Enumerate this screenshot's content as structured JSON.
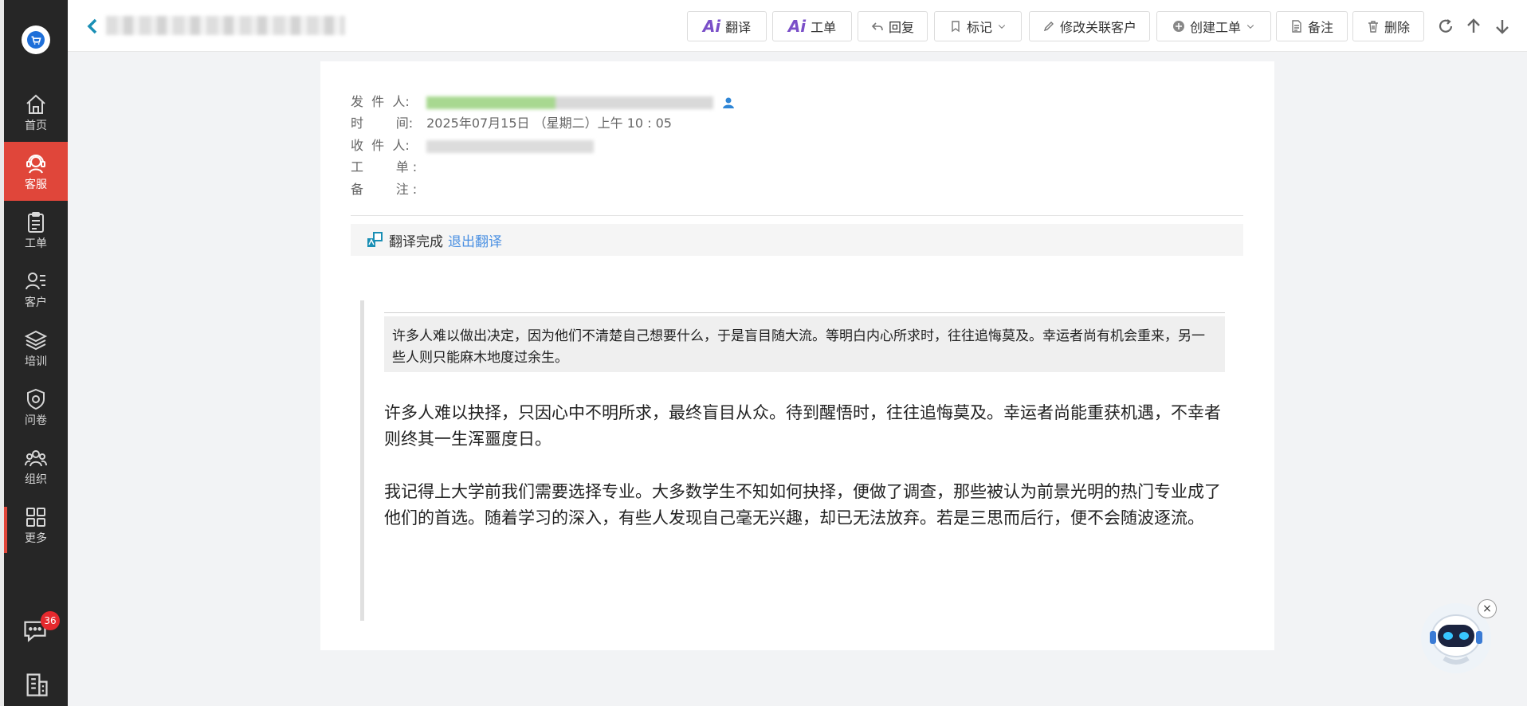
{
  "sidebar": {
    "items": [
      {
        "label": "首页",
        "icon": "home-icon"
      },
      {
        "label": "客服",
        "icon": "headset-icon",
        "active": true
      },
      {
        "label": "工单",
        "icon": "clipboard-icon"
      },
      {
        "label": "客户",
        "icon": "users-list-icon"
      },
      {
        "label": "培训",
        "icon": "layers-icon"
      },
      {
        "label": "问卷",
        "icon": "shield-icon"
      },
      {
        "label": "组织",
        "icon": "group-icon"
      },
      {
        "label": "更多",
        "icon": "grid-icon"
      }
    ],
    "chat_badge": "36",
    "accent_color": "#e0463a",
    "background": "#262626"
  },
  "toolbar": {
    "translate": "翻译",
    "ticket": "工单",
    "reply": "回复",
    "mark": "标记",
    "edit_customer": "修改关联客户",
    "create_ticket": "创建工单",
    "note": "备注",
    "delete": "删除"
  },
  "email": {
    "sender_label": "发  件  人:",
    "time_label": "时        间:",
    "time_value": "2025年07月15日 （星期二）上午 10 : 05",
    "recipient_label": "收  件  人:",
    "ticket_label": "工        单 :",
    "note_label": "备        注 :"
  },
  "translation": {
    "status": "翻译完成",
    "exit": "退出翻译"
  },
  "content": {
    "original": "许多人难以做出决定，因为他们不清楚自己想要什么，于是盲目随大流。等明白内心所求时，往往追悔莫及。幸运者尚有机会重来，另一些人则只能麻木地度过余生。",
    "paragraph1": "许多人难以抉择，只因心中不明所求，最终盲目从众。待到醒悟时，往往追悔莫及。幸运者尚能重获机遇，不幸者则终其一生浑噩度日。",
    "paragraph2": "我记得上大学前我们需要选择专业。大多数学生不知如何抉择，便做了调查，那些被认为前景光明的热门专业成了他们的首选。随着学习的深入，有些人发现自己毫无兴趣，却已无法放弃。若是三思而后行，便不会随波逐流。"
  }
}
